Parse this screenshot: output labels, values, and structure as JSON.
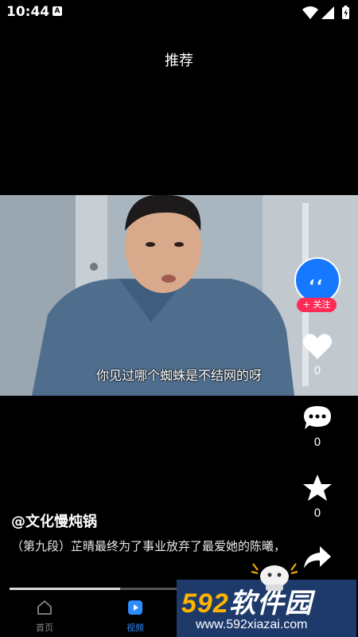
{
  "status_bar": {
    "time": "10:44",
    "badge": "A"
  },
  "header": {
    "title": "推荐"
  },
  "video": {
    "subtitle": "你见过哪个蜘蛛是不结网的呀"
  },
  "side_actions": {
    "follow_label": "+ 关注",
    "like_count": "0",
    "comment_count": "0",
    "favorite_count": "0"
  },
  "post": {
    "author": "@文化慢炖锅",
    "caption": "（第九段）芷晴最终为了事业放弃了最爱她的陈曦，"
  },
  "progress": {
    "played_fraction": 0.66
  },
  "bottom_nav": {
    "items": [
      {
        "label": "首页"
      },
      {
        "label": "视频"
      }
    ]
  },
  "watermark": {
    "logo": "592软件园",
    "logo_number": "592",
    "logo_text": "软件园",
    "url": "www.592xiazai.com"
  },
  "colors": {
    "accent_blue": "#2f8cff",
    "follow_red": "#fe2c55",
    "avatar_blue": "#1677ff"
  }
}
